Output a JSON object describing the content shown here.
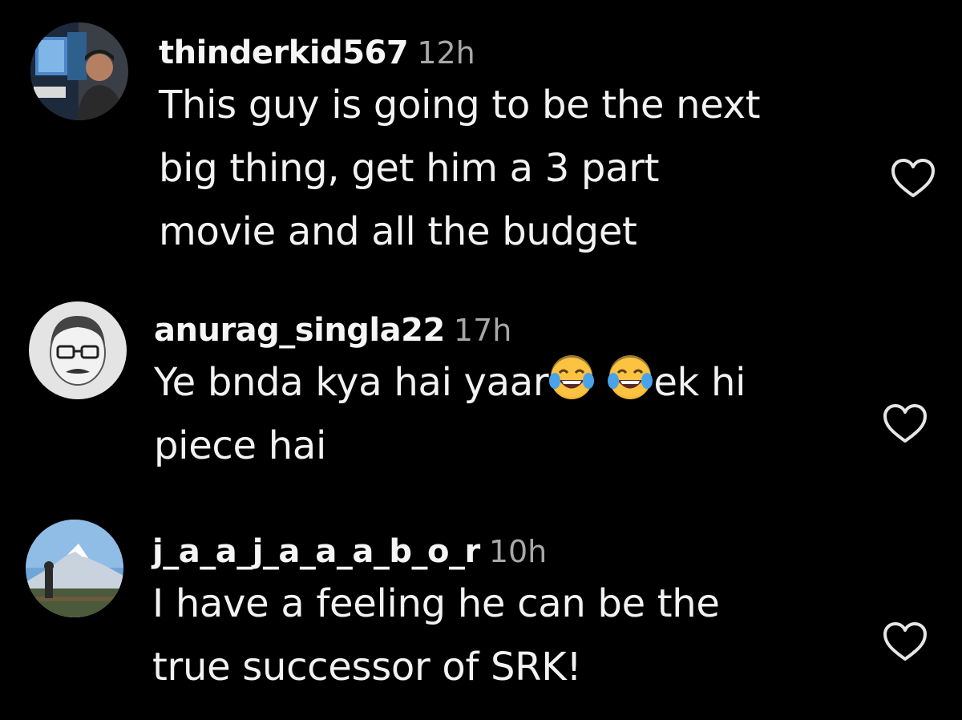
{
  "comments": [
    {
      "username": "thinderkid567",
      "time": "12h",
      "text_lines": [
        "This guy is going to be the next",
        "big thing, get him a 3 part",
        "movie and all the budget"
      ],
      "avatar_icon": "profile-photo-arcade",
      "liked": false
    },
    {
      "username": "anurag_singla22",
      "time": "17h",
      "text_before_emoji": "Ye bnda kya hai yaar",
      "emojis": [
        "face-with-tears-of-joy",
        "face-with-tears-of-joy"
      ],
      "text_after_emoji": "ek hi",
      "text_line2": "piece hai",
      "avatar_icon": "profile-sketch-glasses",
      "liked": false
    },
    {
      "username": "j_a_a_j_a_a_a_b_o_r",
      "time": "10h",
      "text_lines": [
        "I have a feeling he can be the",
        "true successor of SRK!"
      ],
      "avatar_icon": "profile-photo-mountain",
      "liked": false
    }
  ],
  "colors": {
    "background": "#000000",
    "text": "#f2f2f2",
    "time": "#a8a8a8",
    "heart_outline": "#e6e6e6"
  }
}
